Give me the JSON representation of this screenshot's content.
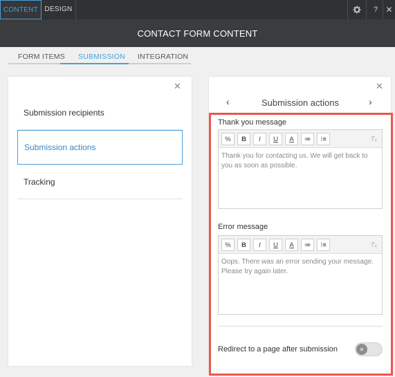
{
  "topbar": {
    "tabs": [
      {
        "label": "CONTENT"
      },
      {
        "label": "DESIGN"
      }
    ],
    "icons": {
      "settings": "gear-icon",
      "help": "?",
      "close": "✕"
    }
  },
  "header": {
    "title": "CONTACT FORM CONTENT"
  },
  "subtabs": [
    {
      "label": "FORM ITEMS"
    },
    {
      "label": "SUBMISSION"
    },
    {
      "label": "INTEGRATION"
    }
  ],
  "left_panel": {
    "items": [
      {
        "label": "Submission recipients"
      },
      {
        "label": "Submission actions"
      },
      {
        "label": "Tracking"
      }
    ]
  },
  "right_panel": {
    "title": "Submission actions",
    "thank_you": {
      "label": "Thank you message",
      "text": "Thank you for contacting us. We will get back to you as soon as possible."
    },
    "error": {
      "label": "Error message",
      "text": "Oops. There was an error sending your message. Please try again later."
    },
    "redirect": {
      "label": "Redirect to a page after submission",
      "enabled": false
    }
  },
  "toolbar_buttons": {
    "link": "%",
    "bold": "B",
    "italic": "I",
    "underline": "U",
    "color": "A",
    "bullets": "≔",
    "numbers": "⁝≡",
    "clear": "Tₓ"
  },
  "colors": {
    "accent": "#4a9fd8",
    "highlight": "#e8594d",
    "dark": "#2f3133"
  }
}
